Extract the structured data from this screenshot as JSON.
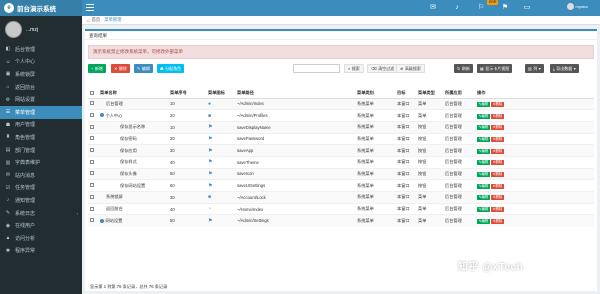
{
  "app": {
    "title": "前台演示系统",
    "logo_letter": "e"
  },
  "navbar": {
    "badge": "ERR",
    "user_name": "mystcz"
  },
  "sidebar": {
    "user_name": "...mzj",
    "items": [
      {
        "label": "后台管理",
        "icon": "dashboard-icon",
        "active": false
      },
      {
        "label": "个人中心",
        "icon": "user-icon",
        "active": false
      },
      {
        "label": "系统锁屏",
        "icon": "lock-icon",
        "active": false
      },
      {
        "label": "返回前台",
        "icon": "home-icon",
        "active": false
      },
      {
        "label": "网站设置",
        "icon": "gear-icon",
        "active": false
      },
      {
        "label": "菜单管理",
        "icon": "menu-icon",
        "active": true
      },
      {
        "label": "用户管理",
        "icon": "users-icon",
        "active": false
      },
      {
        "label": "角色管理",
        "icon": "role-icon",
        "active": false
      },
      {
        "label": "部门管理",
        "icon": "dept-icon",
        "active": false
      },
      {
        "label": "字典表维护",
        "icon": "book-icon",
        "active": false
      },
      {
        "label": "站内消息",
        "icon": "message-icon",
        "active": false
      },
      {
        "label": "任务管理",
        "icon": "task-icon",
        "active": false
      },
      {
        "label": "通知管理",
        "icon": "bell-icon",
        "active": false
      },
      {
        "label": "系统日志",
        "icon": "log-icon",
        "active": false,
        "has_children": true
      },
      {
        "label": "在线用户",
        "icon": "online-icon",
        "active": false
      },
      {
        "label": "访问分析",
        "icon": "chart-icon",
        "active": false
      },
      {
        "label": "程序异常",
        "icon": "bug-icon",
        "active": false
      }
    ]
  },
  "tabs": [
    {
      "label": "首页",
      "active": false
    },
    {
      "label": "菜单管理",
      "active": true
    }
  ],
  "box_title": "查询结果",
  "alert": "演示系统禁止修改系统菜单，可修改外部菜单",
  "toolbar": {
    "add": "新增",
    "delete": "删除",
    "edit": "编辑",
    "assign": "分配角色",
    "search": "搜索",
    "clear": "清空过滤",
    "advanced": "高级搜索",
    "refresh": "刷新",
    "cards": "显示卡片视图",
    "columns": "列",
    "export": "导出数据"
  },
  "table": {
    "headers": [
      "菜单名称",
      "菜单序号",
      "菜单图标",
      "菜单路径",
      "菜单类别",
      "目标",
      "菜单类型",
      "所属应用",
      "操作"
    ],
    "rows": [
      {
        "name": "后台管理",
        "level": 0,
        "expand": false,
        "order": "10",
        "icon": "●",
        "path": "~/Admin/Index",
        "category": "系统菜单",
        "target": "本窗口",
        "type": "菜单",
        "app": "后台管理"
      },
      {
        "name": "个人中心",
        "level": 0,
        "expand": true,
        "order": "20",
        "icon": "■",
        "path": "~/Admin/Profiles",
        "category": "系统菜单",
        "target": "本窗口",
        "type": "菜单",
        "app": "后台管理"
      },
      {
        "name": "保存显示名称",
        "level": 1,
        "expand": false,
        "order": "10",
        "icon": "⚑",
        "path": "saveDisplayName",
        "category": "系统菜单",
        "target": "本窗口",
        "type": "按钮",
        "app": "后台管理"
      },
      {
        "name": "保存密码",
        "level": 1,
        "expand": false,
        "order": "20",
        "icon": "⚑",
        "path": "savePassword",
        "category": "系统菜单",
        "target": "本窗口",
        "type": "按钮",
        "app": "后台管理"
      },
      {
        "name": "保存应用",
        "level": 1,
        "expand": false,
        "order": "30",
        "icon": "⚑",
        "path": "saveApp",
        "category": "系统菜单",
        "target": "本窗口",
        "type": "按钮",
        "app": "后台管理"
      },
      {
        "name": "保存样式",
        "level": 1,
        "expand": false,
        "order": "40",
        "icon": "⚑",
        "path": "saveTheme",
        "category": "系统菜单",
        "target": "本窗口",
        "type": "按钮",
        "app": "后台管理"
      },
      {
        "name": "保存头像",
        "level": 1,
        "expand": false,
        "order": "50",
        "icon": "⚑",
        "path": "saveIcon",
        "category": "系统菜单",
        "target": "本窗口",
        "type": "按钮",
        "app": "后台管理"
      },
      {
        "name": "保存网站设置",
        "level": 1,
        "expand": false,
        "order": "60",
        "icon": "⚑",
        "path": "saveUISettings",
        "category": "系统菜单",
        "target": "本窗口",
        "type": "按钮",
        "app": "后台管理"
      },
      {
        "name": "系统锁屏",
        "level": 0,
        "expand": false,
        "order": "30",
        "icon": "■",
        "path": "~/Account/Lock",
        "category": "系统菜单",
        "target": "本窗口",
        "type": "菜单",
        "app": "后台管理"
      },
      {
        "name": "返回前台",
        "level": 0,
        "expand": false,
        "order": "40",
        "icon": "◔",
        "path": "~/Home/Index",
        "category": "系统菜单",
        "target": "本窗口",
        "type": "菜单",
        "app": "后台管理"
      },
      {
        "name": "网站设置",
        "level": 0,
        "expand": true,
        "order": "50",
        "icon": "⚑",
        "path": "~/Admin/Settings",
        "category": "系统菜单",
        "target": "本窗口",
        "type": "菜单",
        "app": "后台管理"
      }
    ],
    "action_edit": "编辑",
    "action_delete": "删除"
  },
  "pagination_info": "显示第 1 到第 76 条记录，总共 76 条记录",
  "watermark": "知乎 @xTech"
}
